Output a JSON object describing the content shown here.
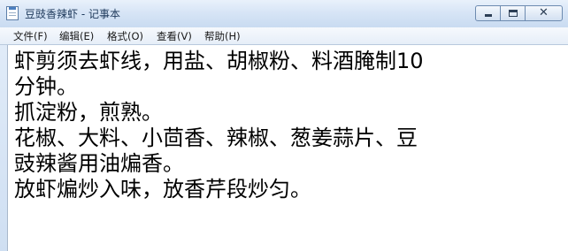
{
  "window": {
    "title": "豆豉香辣虾 - 记事本",
    "app_icon": "notepad-icon"
  },
  "caption_buttons": {
    "minimize": "minimize-icon",
    "maximize": "maximize-icon",
    "close": "close-icon",
    "close_glyph": "✕"
  },
  "menu": {
    "items": [
      {
        "label": "文件(F)"
      },
      {
        "label": "编辑(E)"
      },
      {
        "label": "格式(O)"
      },
      {
        "label": "查看(V)"
      },
      {
        "label": "帮助(H)"
      }
    ]
  },
  "document": {
    "lines": [
      "虾剪须去虾线，用盐、胡椒粉、料酒腌制10",
      "分钟。",
      "抓淀粉，煎熟。",
      "花椒、大料、小茴香、辣椒、葱姜蒜片、豆",
      "豉辣酱用油煸香。",
      "放虾煸炒入味，放香芹段炒匀。"
    ]
  },
  "colors": {
    "titlebar": "#d7e5f6",
    "title_text": "#1e395b",
    "editor_background": "#ffffff"
  }
}
